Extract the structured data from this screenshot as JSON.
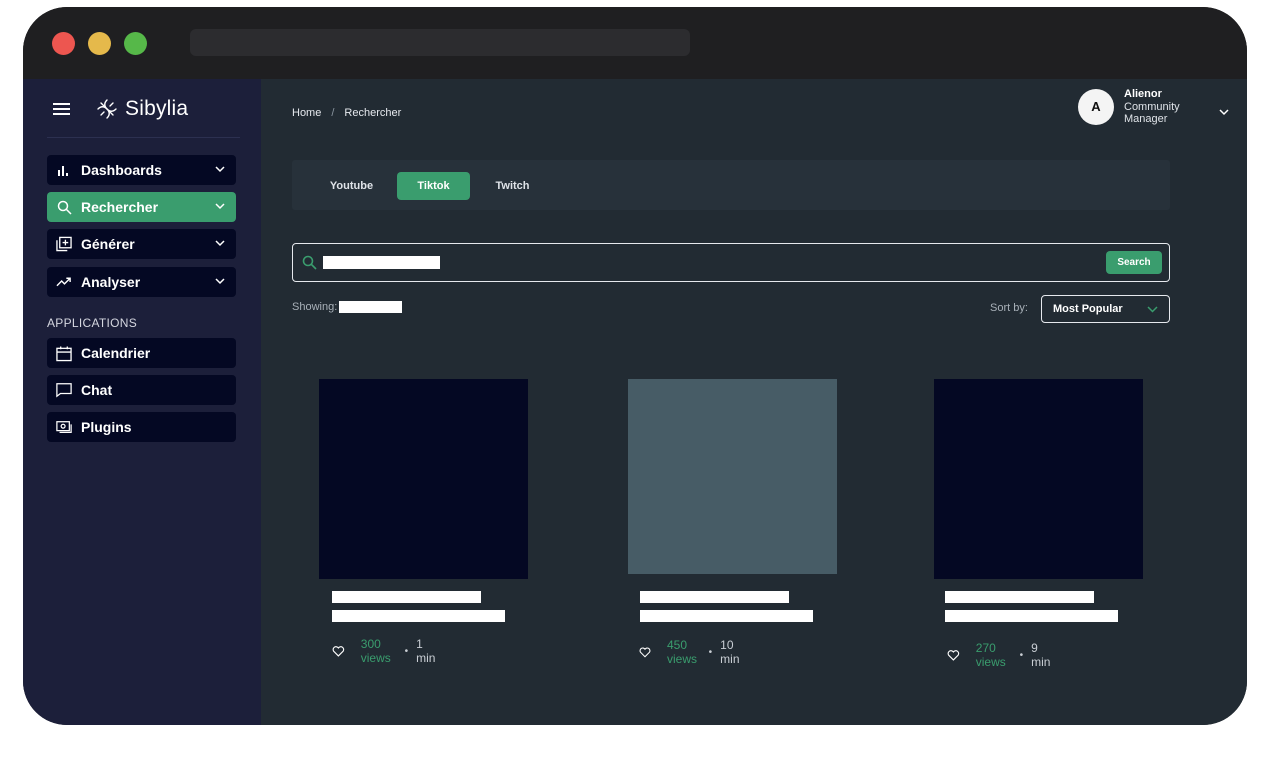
{
  "app": {
    "name": "Sibylia"
  },
  "sidebar": {
    "menu": [
      {
        "label": "Dashboards",
        "icon": "bar-chart-icon"
      },
      {
        "label": "Rechercher",
        "icon": "search-icon",
        "active": true
      },
      {
        "label": "Générer",
        "icon": "add-box-icon"
      },
      {
        "label": "Analyser",
        "icon": "trend-icon"
      }
    ],
    "section_label": "APPLICATIONS",
    "apps": [
      {
        "label": "Calendrier",
        "icon": "calendar-icon"
      },
      {
        "label": "Chat",
        "icon": "chat-bubble-icon"
      },
      {
        "label": "Plugins",
        "icon": "plugin-icon"
      }
    ]
  },
  "breadcrumb": {
    "home": "Home",
    "separator": "/",
    "current": "Rechercher"
  },
  "user": {
    "initial": "A",
    "name": "Alienor",
    "role_line1": "Community",
    "role_line2": "Manager"
  },
  "tabs": [
    "Youtube",
    "Tiktok",
    "Twitch"
  ],
  "active_tab": "Tiktok",
  "search": {
    "value": "",
    "button": "Search"
  },
  "showing": {
    "label": "Showing:",
    "value": ""
  },
  "sort": {
    "label": "Sort by:",
    "value": "Most Popular"
  },
  "cards": [
    {
      "views": "300 views",
      "separator": "•",
      "duration": "1 min",
      "thumb_color": "#040823"
    },
    {
      "views": "450 views",
      "separator": "•",
      "duration": "10 min",
      "thumb_color": "#475c66"
    },
    {
      "views": "270 views",
      "separator": "•",
      "duration": "9 min",
      "thumb_color": "#040823"
    }
  ],
  "colors": {
    "accent": "#3a9d6e",
    "sidebar": "#1c1f3a",
    "content": "#222b33",
    "nav_item": "#040823"
  }
}
